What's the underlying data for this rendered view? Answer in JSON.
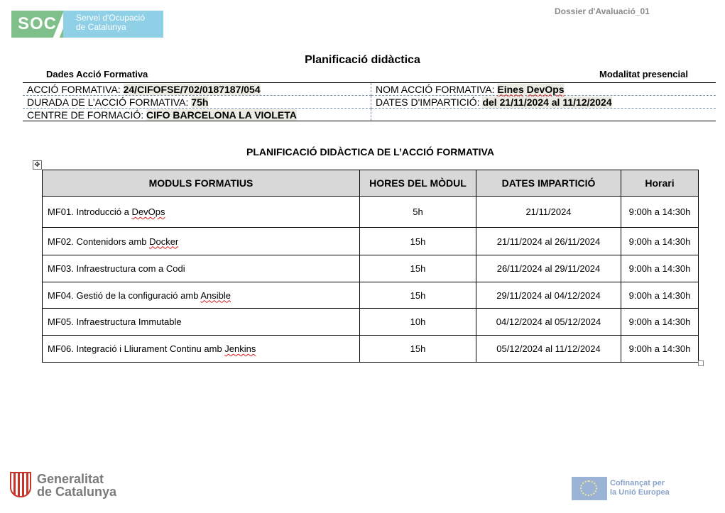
{
  "header": {
    "soc_logo": {
      "short": "SOC",
      "line1": "Servei d'Ocupació",
      "line2": "de Catalunya"
    },
    "doc_code": "Dossier d'Avaluació_01",
    "title": "Planificació didàctica"
  },
  "info": {
    "dades_label": "Dades Acció Formativa",
    "modalitat_label": "Modalitat presencial",
    "accio_label": "ACCIÓ FORMATIVA:",
    "accio_value": "24/CIFOFSE/702/0187187/054",
    "nom_label": "NOM ACCIÓ FORMATIVA:",
    "nom_value_1": "Eines",
    "nom_value_2": "DevOps",
    "durada_label": "DURADA DE L’ACCIÓ FORMATIVA",
    "durada_colon": ":",
    "durada_value": "75h",
    "dates_label": "DATES D'IMPARTICIÓ:",
    "dates_value": "del 21/11/2024 al 11/12/2024",
    "centre_label": "CENTRE DE FORMACIÓ:",
    "centre_value": "CIFO BARCELONA LA VIOLETA"
  },
  "plan": {
    "title": "PLANIFICACIÓ DIDÀCTICA DE L’ACCIÓ FORMATIVA",
    "move_handle_glyph": "✥",
    "columns": [
      "MODULS FORMATIUS",
      "HORES DEL MÒDUL",
      "DATES IMPARTICIÓ",
      "Horari"
    ],
    "rows": [
      {
        "module_prefix": "MF01. Introducció a ",
        "module_term": "DevOps",
        "hours": "5h",
        "dates": "21/11/2024",
        "schedule": "9:00h a 14:30h"
      },
      {
        "module_prefix": "MF02. Contenidors amb ",
        "module_term": "Docker ",
        "hours": "15h",
        "dates": "21/11/2024 al 26/11/2024",
        "schedule": "9:00h a 14:30h"
      },
      {
        "module_prefix": "MF03. Infraestructura com a Codi",
        "module_term": "",
        "hours": "15h",
        "dates": "26/11/2024 al 29/11/2024",
        "schedule": "9:00h a 14:30h"
      },
      {
        "module_prefix": "MF04. Gestió de la configuració amb ",
        "module_term": "Ansible",
        "hours": "15h",
        "dates": "29/11/2024 al 04/12/2024",
        "schedule": "9:00h a 14:30h"
      },
      {
        "module_prefix": "MF05. Infraestructura Immutable",
        "module_term": "",
        "hours": "10h",
        "dates": "04/12/2024 al 05/12/2024",
        "schedule": "9:00h a 14:30h"
      },
      {
        "module_prefix": "MF06. Integració i Lliurament Continu amb ",
        "module_term": "Jenkins",
        "hours": "15h",
        "dates": "05/12/2024 al 11/12/2024",
        "schedule": "9:00h a 14:30h"
      }
    ]
  },
  "footer": {
    "gencat_line1": "Generalitat",
    "gencat_line2": "de Catalunya",
    "eu_line1": "Cofinançat per",
    "eu_line2": "la Unió Europea"
  }
}
